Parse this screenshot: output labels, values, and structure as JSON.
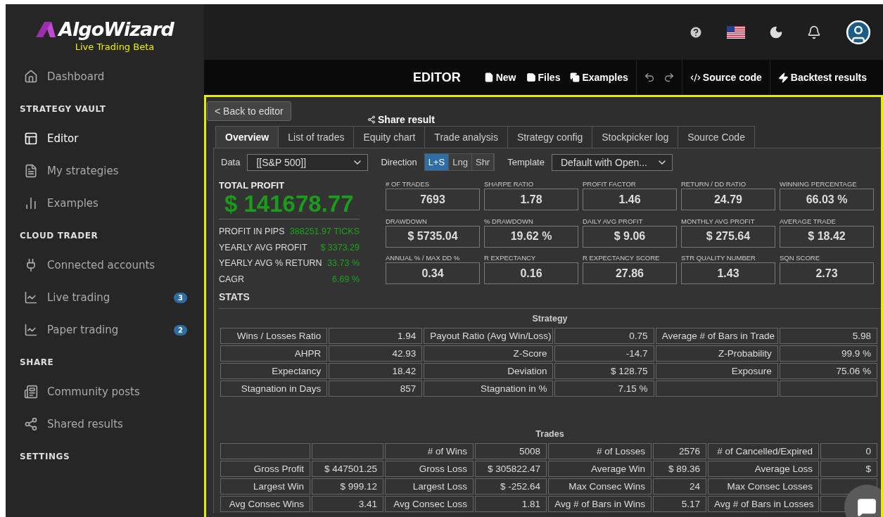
{
  "sidebar": {
    "logo": {
      "name": "AlgoWizard",
      "subtitle": "Live Trading Beta"
    },
    "sections": [
      {
        "items": [
          {
            "label": "Dashboard",
            "selected": false
          }
        ]
      },
      {
        "heading": "STRATEGY VAULT",
        "items": [
          {
            "label": "Editor",
            "selected": true
          },
          {
            "label": "My strategies",
            "selected": false
          },
          {
            "label": "Examples",
            "selected": false
          }
        ]
      },
      {
        "heading": "CLOUD TRADER",
        "items": [
          {
            "label": "Connected accounts",
            "selected": false
          },
          {
            "label": "Live trading",
            "selected": false,
            "badge": "3"
          },
          {
            "label": "Paper trading",
            "selected": false,
            "badge": "2"
          }
        ]
      },
      {
        "heading": "SHARE",
        "items": [
          {
            "label": "Community posts",
            "selected": false
          },
          {
            "label": "Shared results",
            "selected": false
          }
        ]
      },
      {
        "heading": "SETTINGS"
      }
    ]
  },
  "toolbar": {
    "title": "EDITOR",
    "buttons": [
      "New",
      "Files",
      "Examples"
    ],
    "links": [
      "Source code",
      "Backtest results"
    ]
  },
  "panel": {
    "back_button": "< Back to editor",
    "share": "Share result",
    "tabs": [
      {
        "label": "Overview",
        "selected": true
      },
      {
        "label": "List of trades",
        "selected": false
      },
      {
        "label": "Equity chart",
        "selected": false
      },
      {
        "label": "Trade analysis",
        "selected": false
      },
      {
        "label": "Strategy config",
        "selected": false
      },
      {
        "label": "Stockpicker log",
        "selected": false
      },
      {
        "label": "Source Code",
        "selected": false
      }
    ],
    "filters": {
      "data_label": "Data",
      "data_value": "[[S&P 500]]",
      "direction_label": "Direction",
      "directions": [
        {
          "label": "L+S",
          "selected": true
        },
        {
          "label": "Lng",
          "selected": false
        },
        {
          "label": "Shr",
          "selected": false
        }
      ],
      "template_label": "Template",
      "template_value": "Default with Open..."
    },
    "total_profit": {
      "label": "TOTAL PROFIT",
      "value": "$ 141678.77"
    },
    "side_stats": [
      {
        "label": "PROFIT IN PIPS",
        "value": "388251.97 TICKS"
      },
      {
        "label": "YEARLY AVG PROFIT",
        "value": "$ 3373.29"
      },
      {
        "label": "YEARLY AVG % RETURN",
        "value": "33.73 %"
      },
      {
        "label": "CAGR",
        "value": "6.69 %"
      }
    ],
    "metrics": [
      {
        "label": "# OF TRADES",
        "value": "7693"
      },
      {
        "label": "SHARPE RATIO",
        "value": "1.78"
      },
      {
        "label": "PROFIT FACTOR",
        "value": "1.46"
      },
      {
        "label": "RETURN / DD RATIO",
        "value": "24.79"
      },
      {
        "label": "WINNING PERCENTAGE",
        "value": "66.03 %"
      },
      {
        "label": "DRAWDOWN",
        "value": "$ 5735.04"
      },
      {
        "label": "% DRAWDOWN",
        "value": "19.62 %"
      },
      {
        "label": "DAILY AVG PROFIT",
        "value": "$ 9.06"
      },
      {
        "label": "MONTHLY AVG PROFIT",
        "value": "$ 275.64"
      },
      {
        "label": "AVERAGE TRADE",
        "value": "$ 18.42"
      },
      {
        "label": "ANNUAL % / MAX DD %",
        "value": "0.34"
      },
      {
        "label": "R EXPECTANCY",
        "value": "0.16"
      },
      {
        "label": "R EXPECTANCY SCORE",
        "value": "27.86"
      },
      {
        "label": "STR QUALITY NUMBER",
        "value": "1.43"
      },
      {
        "label": "SQN SCORE",
        "value": "2.73"
      }
    ],
    "stats_heading": "STATS",
    "strategy_table": {
      "title": "Strategy",
      "rows": [
        [
          "Wins / Losses Ratio",
          "1.94",
          "Payout Ratio (Avg Win/Loss)",
          "0.75",
          "Average # of Bars in Trade",
          "5.98"
        ],
        [
          "AHPR",
          "42.93",
          "Z-Score",
          "-14.7",
          "Z-Probability",
          "99.9 %"
        ],
        [
          "Expectancy",
          "18.42",
          "Deviation",
          "$ 128.75",
          "Exposure",
          "75.06 %"
        ],
        [
          "Stagnation in Days",
          "857",
          "Stagnation in %",
          "7.15 %",
          null,
          null
        ]
      ]
    },
    "trades_table": {
      "title": "Trades",
      "rows": [
        [
          null,
          null,
          "# of Wins",
          "5008",
          "# of Losses",
          "2576",
          "# of Cancelled/Expired",
          "0"
        ],
        [
          "Gross Profit",
          "$ 447501.25",
          "Gross Loss",
          "$ 305822.47",
          "Average Win",
          "$ 89.36",
          "Average Loss",
          "$"
        ],
        [
          "Largest Win",
          "$ 999.12",
          "Largest Loss",
          "$ -252.64",
          "Max Consec Wins",
          "24",
          "Max Consec Losses",
          null
        ],
        [
          "Avg Consec Wins",
          "3.41",
          "Avg Consec Loss",
          "1.81",
          "Avg # of Bars in Wins",
          "5.17",
          "Avg # of Bars in Losses",
          null
        ]
      ]
    }
  }
}
